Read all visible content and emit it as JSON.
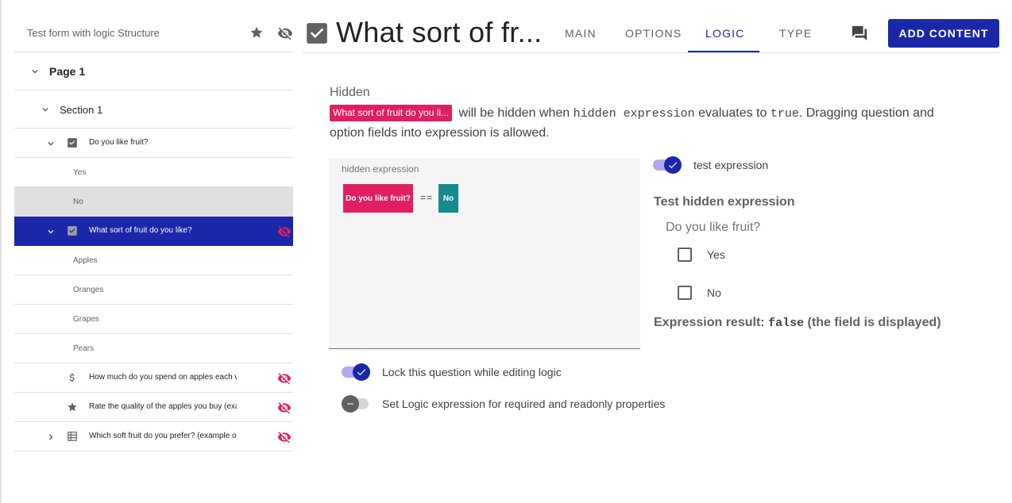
{
  "sidebar": {
    "form_title": "Test form with logic Structure",
    "page_label": "Page 1",
    "section_label": "Section 1",
    "q1": {
      "label": "Do you like fruit?",
      "options": [
        "Yes",
        "No"
      ]
    },
    "q2": {
      "label": "What sort of fruit do you like?",
      "options": [
        "Apples",
        "Oranges",
        "Grapes",
        "Pears"
      ]
    },
    "q3": {
      "label": "How much do you spend on apples each w"
    },
    "q4": {
      "label": "Rate the quality of the apples you buy (exa"
    },
    "q5": {
      "label": "Which soft fruit do you prefer? (example o"
    }
  },
  "header": {
    "title": "What sort of fr...",
    "tabs": [
      "MAIN",
      "OPTIONS",
      "LOGIC",
      "TYPE"
    ],
    "active_tab": "LOGIC",
    "add_button": "ADD CONTENT"
  },
  "logic": {
    "section_label": "Hidden",
    "chip_text": "What sort of fruit do you li...",
    "desc_1": "will be hidden when",
    "desc_code_1": "hidden expression",
    "desc_2": "evaluates to",
    "desc_code_2": "true",
    "desc_3": ". Dragging question and option fields into expression is allowed.",
    "expr_label": "hidden expression",
    "expr_question": "Do you like fruit?",
    "expr_operator": "==",
    "expr_value": "No",
    "test_toggle_label": "test expression",
    "test_title": "Test hidden expression",
    "test_question": "Do you like fruit?",
    "test_options": [
      "Yes",
      "No"
    ],
    "result_prefix": "Expression result:",
    "result_value": "false",
    "result_suffix": "(the field is displayed)",
    "lock_label": "Lock this question while editing logic",
    "required_label": "Set Logic expression for required and readonly properties"
  },
  "colors": {
    "primary": "#1a27a8",
    "pink": "#e01f63",
    "teal": "#168a8f"
  }
}
